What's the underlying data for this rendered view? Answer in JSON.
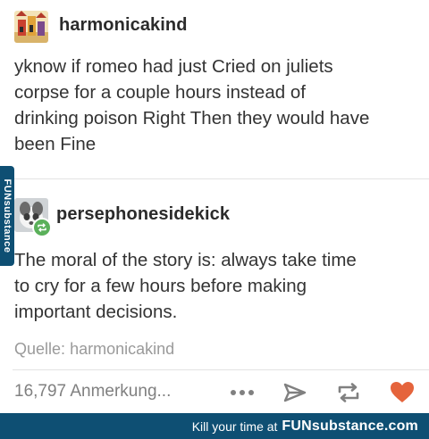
{
  "post": {
    "original": {
      "username": "harmonicakind",
      "text_lines": [
        "yknow if romeo had just Cried on juliets",
        "corpse for a couple hours instead of",
        "drinking poison Right Then they would have",
        "been Fine"
      ],
      "avatar_icon": "castle-avatar-icon"
    },
    "reblog": {
      "username": "persephonesidekick",
      "text_lines": [
        "The moral of the story is: always take time",
        "to cry for a few hours before making",
        "important decisions."
      ],
      "avatar_icon": "animal-avatar-icon",
      "badge_icon": "reblog-badge-icon"
    },
    "source": {
      "label": "Quelle:",
      "user": "harmonicakind"
    },
    "notes": "16,797 Anmerkung...",
    "actions": {
      "more_icon": "more-dots-icon",
      "share_icon": "share-send-icon",
      "reblog_icon": "reblog-icon",
      "like_icon": "heart-icon"
    }
  },
  "footer": {
    "tagline": "Kill your time at",
    "brand": "FUNsubstance.com"
  },
  "watermark": {
    "text": "FUNsubstance"
  },
  "colors": {
    "footer_bg": "#0e4f73",
    "like": "#e5643c",
    "reblog_badge": "#5ab05a",
    "muted_text": "#9a9a9a"
  }
}
